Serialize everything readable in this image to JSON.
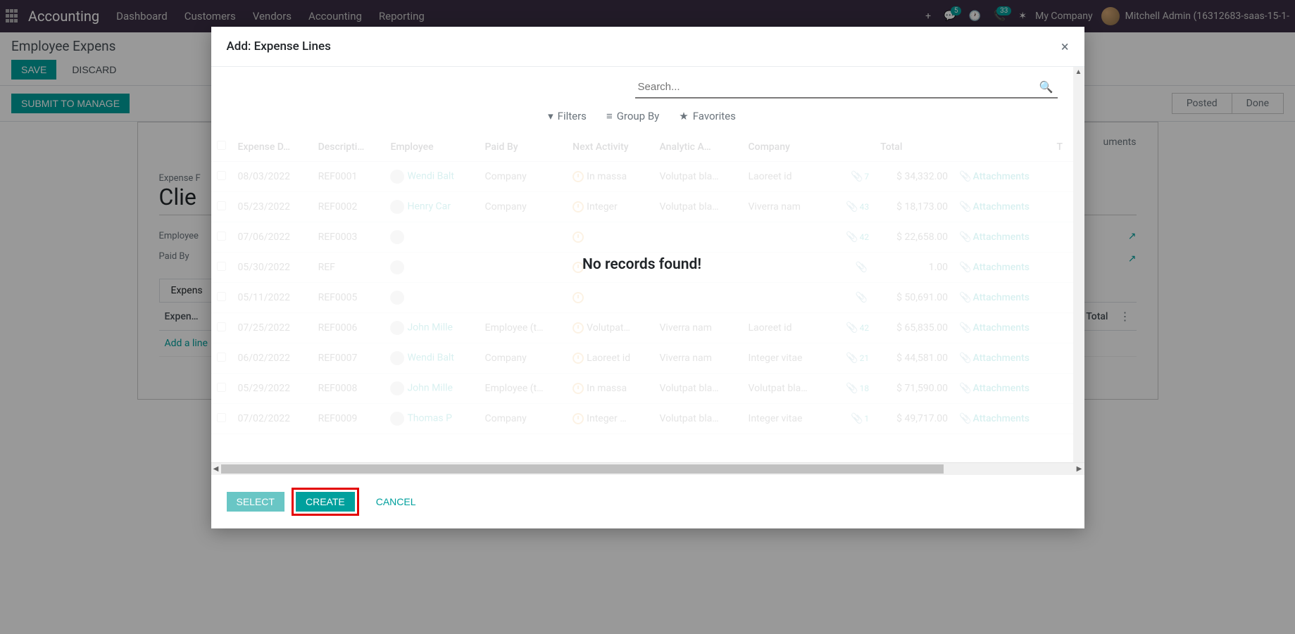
{
  "navbar": {
    "brand": "Accounting",
    "menu": [
      "Dashboard",
      "Customers",
      "Vendors",
      "Accounting",
      "Reporting"
    ],
    "badge1": "5",
    "badge2": "33",
    "company": "My Company",
    "user": "Mitchell Admin (16312683-saas-15-1-"
  },
  "bg": {
    "page_title": "Employee Expens",
    "save": "Save",
    "discard": "Discard",
    "submit": "Submit to Manage",
    "posted": "Posted",
    "done": "Done",
    "docs": "uments",
    "expense_p_label": "Expense F",
    "h1": "Clie",
    "employee_label": "Employee",
    "paidby_label": "Paid By",
    "tab": "Expens",
    "add_line": "Add a line",
    "cols": {
      "expen": "Expen…",
      "total": "Total"
    }
  },
  "dialog": {
    "title": "Add: Expense Lines",
    "search_placeholder": "Search...",
    "filters": "Filters",
    "groupby": "Group By",
    "favorites": "Favorites",
    "no_records": "No records found!",
    "columns": {
      "date": "Expense D…",
      "desc": "Descripti…",
      "employee": "Employee",
      "paidby": "Paid By",
      "activity": "Next Activity",
      "analytic": "Analytic A…",
      "company": "Company",
      "total": "Total",
      "t": "T"
    },
    "rows": [
      {
        "date": "08/03/2022",
        "ref": "REF0001",
        "emp": "Wendi Balt",
        "paid": "Company",
        "act": "In massa",
        "ana": "Volutpat bla…",
        "co": "Laoreet id",
        "cnt": "7",
        "total": "$ 34,332.00"
      },
      {
        "date": "05/23/2022",
        "ref": "REF0002",
        "emp": "Henry Car",
        "paid": "Company",
        "act": "Integer",
        "ana": "Volutpat bla…",
        "co": "Viverra nam",
        "cnt": "43",
        "total": "$ 18,173.00"
      },
      {
        "date": "07/06/2022",
        "ref": "REF0003",
        "emp": "",
        "paid": "",
        "act": "",
        "ana": "",
        "co": "",
        "cnt": "42",
        "total": "$ 22,658.00"
      },
      {
        "date": "05/30/2022",
        "ref": "REF",
        "emp": "",
        "paid": "",
        "act": "",
        "ana": "",
        "co": "",
        "cnt": "",
        "total": "1.00"
      },
      {
        "date": "05/11/2022",
        "ref": "REF0005",
        "emp": "",
        "paid": "",
        "act": "",
        "ana": "",
        "co": "",
        "cnt": "",
        "total": "$ 50,691.00"
      },
      {
        "date": "07/25/2022",
        "ref": "REF0006",
        "emp": "John Mille",
        "paid": "Employee (t…",
        "act": "Volutpat…",
        "ana": "Viverra nam",
        "co": "Laoreet id",
        "cnt": "42",
        "total": "$ 65,835.00"
      },
      {
        "date": "06/02/2022",
        "ref": "REF0007",
        "emp": "Wendi Balt",
        "paid": "Company",
        "act": "Laoreet id",
        "ana": "Viverra nam",
        "co": "Integer vitae",
        "cnt": "21",
        "total": "$ 44,581.00"
      },
      {
        "date": "05/29/2022",
        "ref": "REF0008",
        "emp": "John Mille",
        "paid": "Employee (t…",
        "act": "In massa",
        "ana": "Volutpat bla…",
        "co": "Volutpat bla…",
        "cnt": "18",
        "total": "$ 71,590.00"
      },
      {
        "date": "07/02/2022",
        "ref": "REF0009",
        "emp": "Thomas P",
        "paid": "Company",
        "act": "Integer …",
        "ana": "Volutpat bla…",
        "co": "Integer vitae",
        "cnt": "1",
        "total": "$ 49,717.00"
      }
    ],
    "attachments_label": "Attachments",
    "select": "Select",
    "create": "Create",
    "cancel": "Cancel"
  }
}
